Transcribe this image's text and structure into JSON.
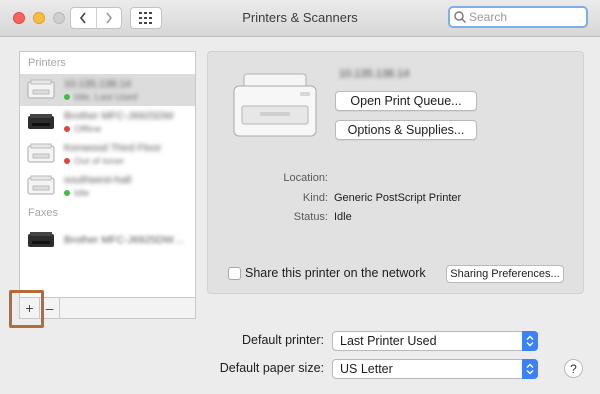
{
  "window": {
    "title": "Printers & Scanners"
  },
  "search": {
    "placeholder": "Search"
  },
  "list": {
    "printers_header": "Printers",
    "faxes_header": "Faxes",
    "printers": [
      {
        "name": "10.135.138.14",
        "status": "Idle, Last Used",
        "status_color": "#3fbf3f",
        "icon": "laser-printer-icon",
        "selected": true
      },
      {
        "name": "Brother MFC-J6925DW",
        "status": "Offline",
        "status_color": "#e0463e",
        "icon": "inkjet-printer-icon"
      },
      {
        "name": "Kenwood Third Floor",
        "status": "Out of toner",
        "status_color": "#e0463e",
        "icon": "laser-printer-icon"
      },
      {
        "name": "southwest-hall",
        "status": "Idle",
        "status_color": "#3fbf3f",
        "icon": "laser-printer-icon"
      }
    ],
    "faxes": [
      {
        "name": "Brother MFC-J6925DW…",
        "icon": "fax-printer-icon"
      }
    ],
    "add_label": "+",
    "remove_label": "–"
  },
  "detail": {
    "printer_name": "10.135.138.14",
    "open_queue_label": "Open Print Queue...",
    "options_label": "Options & Supplies...",
    "location_label": "Location:",
    "location_value": "",
    "kind_label": "Kind:",
    "kind_value": "Generic PostScript Printer",
    "status_label": "Status:",
    "status_value": "Idle",
    "share_label": "Share this printer on the network",
    "sharing_prefs_label": "Sharing Preferences..."
  },
  "footer": {
    "default_printer_label": "Default printer:",
    "default_printer_value": "Last Printer Used",
    "paper_size_label": "Default paper size:",
    "paper_size_value": "US Letter",
    "help_label": "?"
  },
  "colors": {
    "accent": "#3b82f7",
    "highlight_box": "#b56a3a"
  }
}
